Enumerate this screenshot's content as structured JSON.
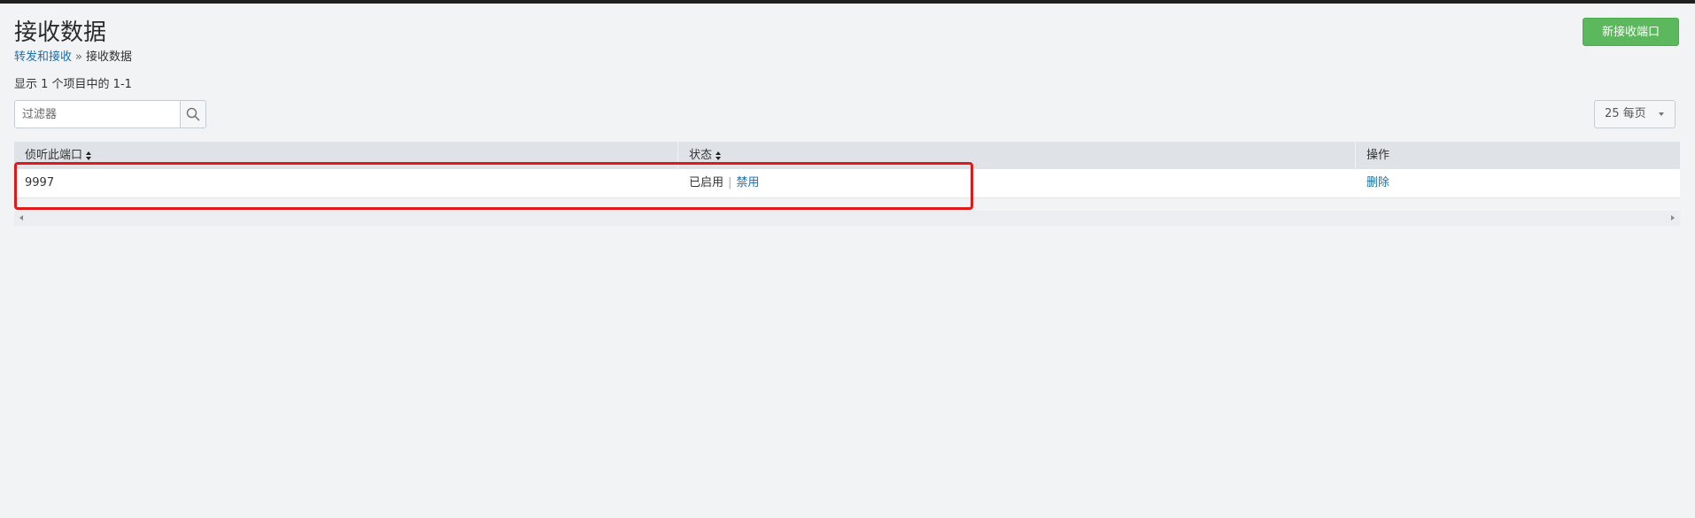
{
  "header": {
    "title": "接收数据",
    "new_button_label": "新接收端口"
  },
  "breadcrumb": {
    "parent_label": "转发和接收",
    "separator": "»",
    "current_label": "接收数据"
  },
  "summary": {
    "count_text": "显示 1 个项目中的 1-1"
  },
  "filter": {
    "placeholder": "过滤器",
    "value": ""
  },
  "pagination": {
    "per_page_label": "25 每页"
  },
  "table": {
    "columns": [
      {
        "label": "侦听此端口"
      },
      {
        "label": "状态"
      },
      {
        "label": "操作"
      }
    ],
    "rows": [
      {
        "port": "9997",
        "status": "已启用",
        "status_separator": "|",
        "toggle_action": "禁用",
        "delete_action": "删除"
      }
    ]
  },
  "colors": {
    "primary_button": "#5cb85c",
    "link": "#1a6fb1",
    "highlight_border": "#e01a1a"
  }
}
